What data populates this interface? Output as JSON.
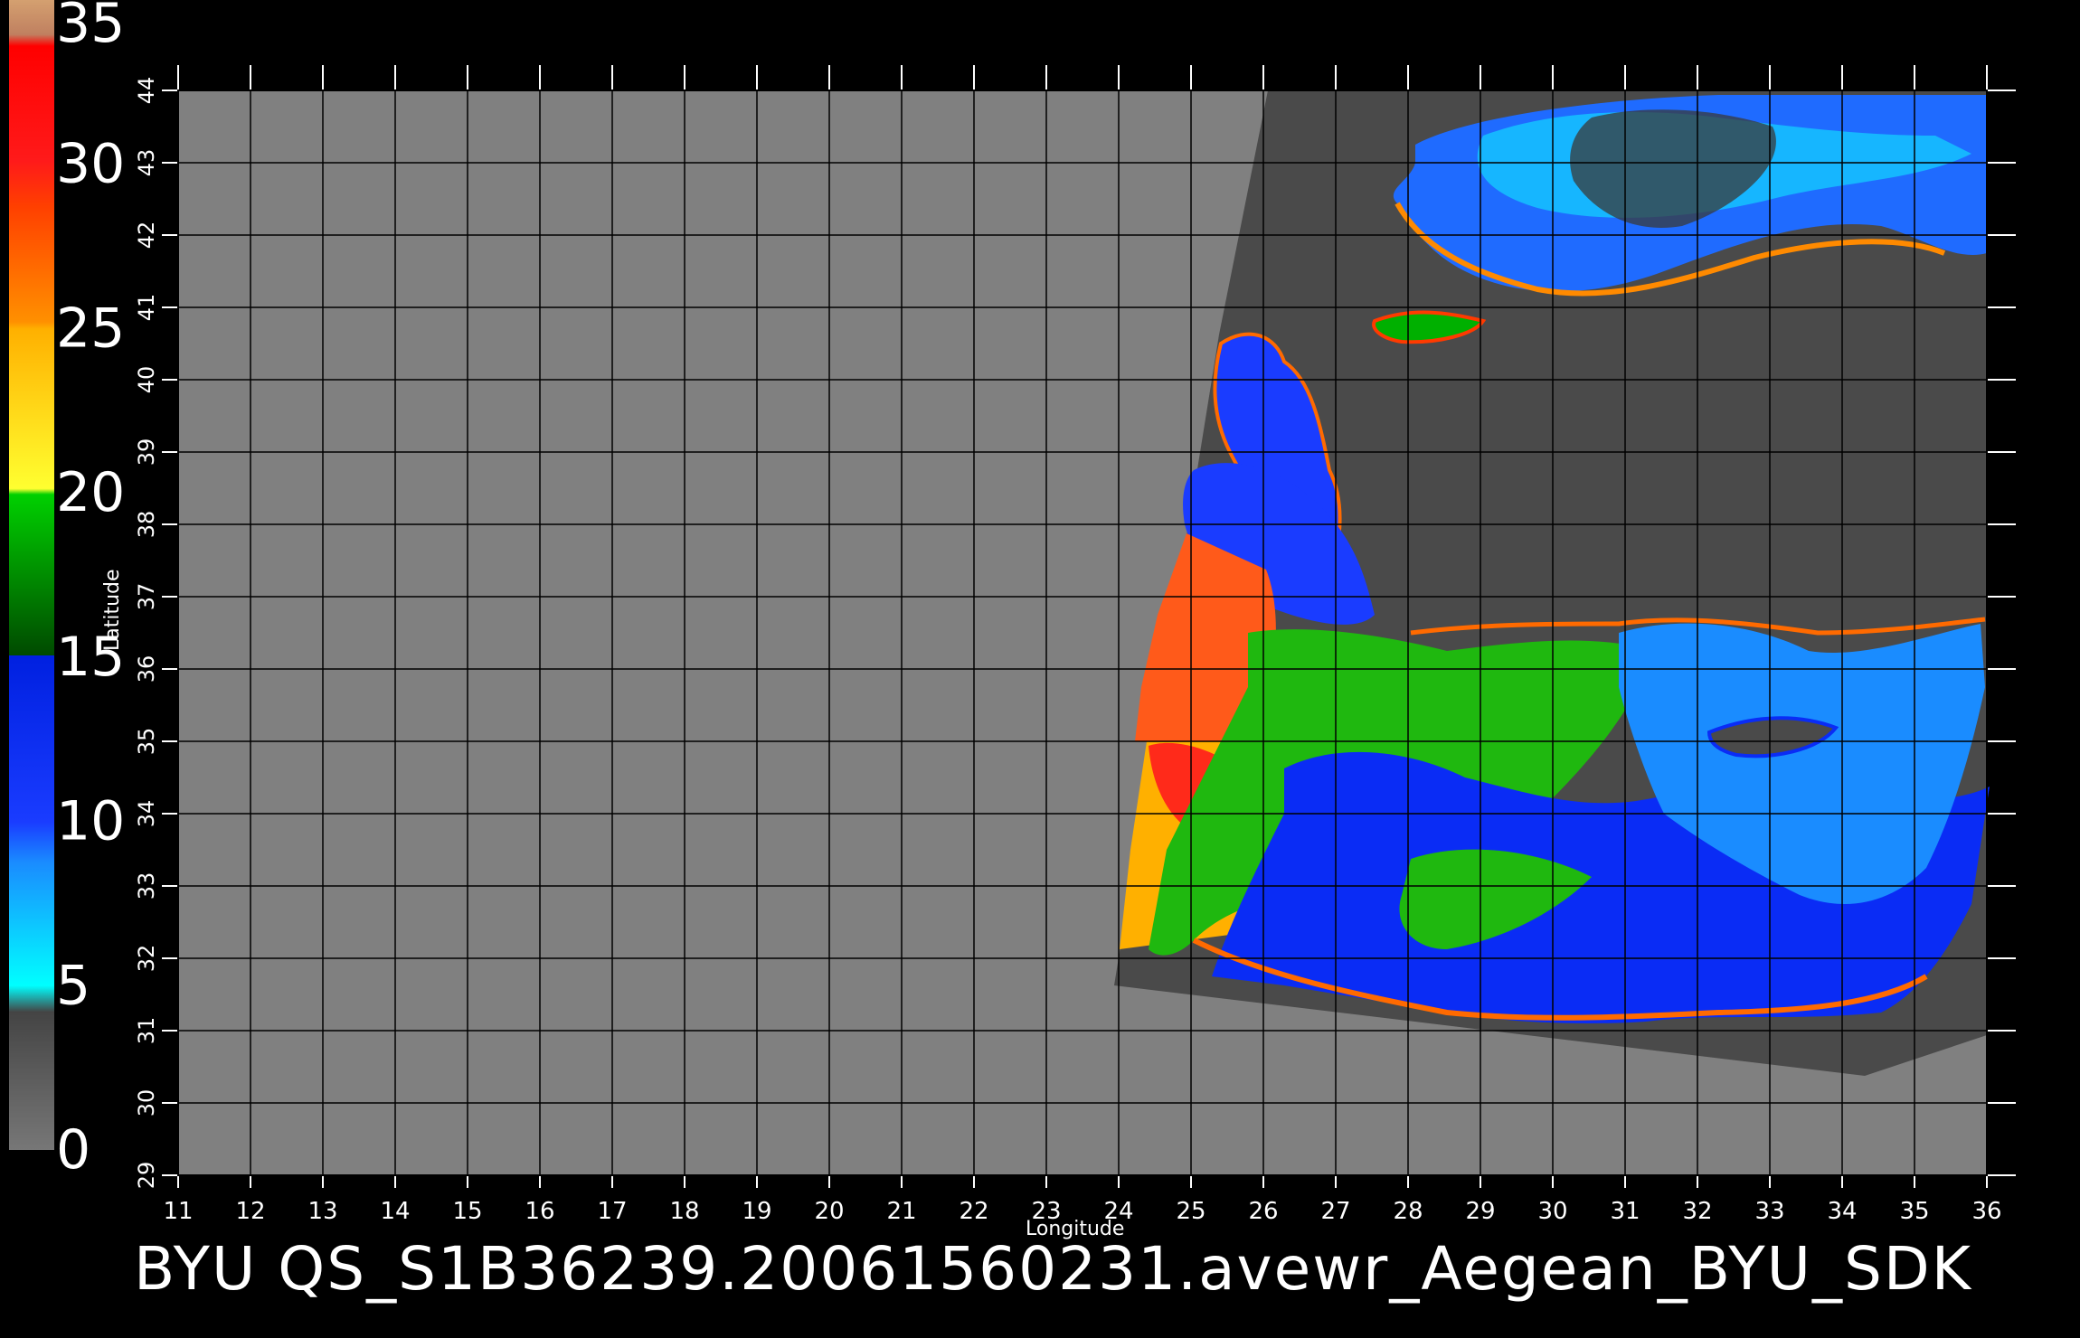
{
  "footer_title": "BYU  QS_S1B36239.20061560231.avewr_Aegean_BYU_SDK",
  "axes": {
    "xlabel": "Longitude",
    "ylabel": "Latitude",
    "lon_ticks": [
      "11",
      "12",
      "13",
      "14",
      "15",
      "16",
      "17",
      "18",
      "19",
      "20",
      "21",
      "22",
      "23",
      "24",
      "25",
      "26",
      "27",
      "28",
      "29",
      "30",
      "31",
      "32",
      "33",
      "34",
      "35",
      "36"
    ],
    "lat_ticks": [
      "29",
      "30",
      "31",
      "32",
      "33",
      "34",
      "35",
      "36",
      "37",
      "38",
      "39",
      "40",
      "41",
      "42",
      "43",
      "44"
    ],
    "lon_range": [
      11,
      36
    ],
    "lat_range": [
      29,
      44
    ]
  },
  "colorbar": {
    "labels": [
      "35",
      "30",
      "25",
      "20",
      "15",
      "10",
      "5",
      "0"
    ],
    "range": [
      0,
      35
    ],
    "colors": {
      "0-5": "#6e6e6e",
      "5-10": "#00ccff",
      "10-15": "#1a3cff",
      "15-20": "#00a800",
      "20-25": "#ffd000",
      "25-30": "#ff6a00",
      "30-35": "#ff1a1a",
      "top": "#d4a070"
    }
  },
  "map_colors": {
    "no_data": "#808080",
    "land": "#4a4a4a",
    "background": "#000000",
    "grid": "#000000"
  }
}
